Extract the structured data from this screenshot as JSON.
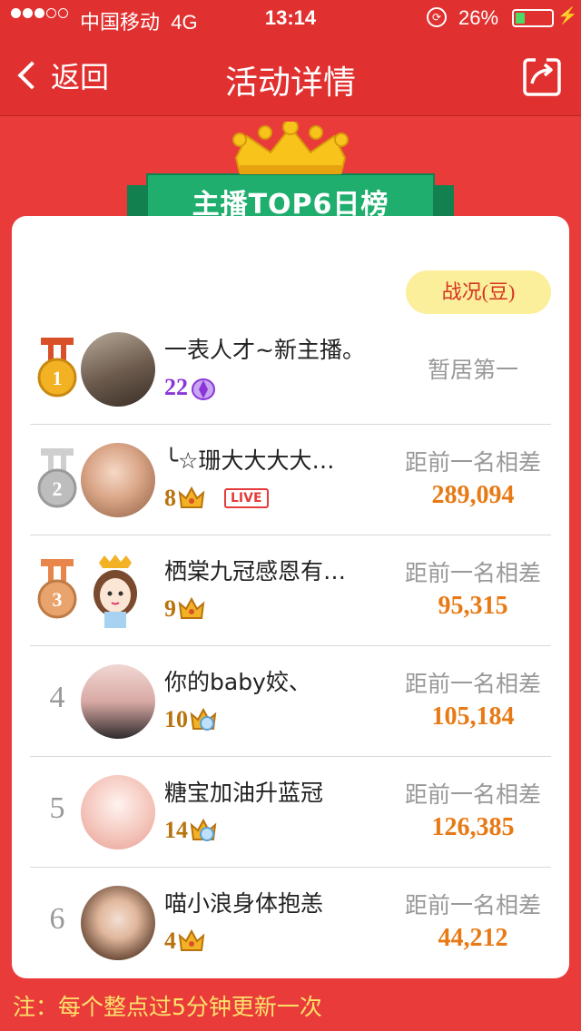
{
  "status_bar": {
    "carrier": "中国移动",
    "network": "4G",
    "time": "13:14",
    "battery": "26%",
    "battery_level": 0.26
  },
  "nav": {
    "back_label": "返回",
    "title": "活动详情"
  },
  "banner": {
    "title": "主播TOP6日榜"
  },
  "status_button": "战况(豆)",
  "rankings": [
    {
      "rank": "1",
      "name": "一表人才~新主播。",
      "level": "22",
      "level_icon": "diamond-crown-icon",
      "status": "暂居第一"
    },
    {
      "rank": "2",
      "name": "╰☆珊大大大大…",
      "level": "8",
      "level_icon": "crown-icon",
      "live": "LIVE",
      "gap_label": "距前一名相差",
      "gap": "289,094"
    },
    {
      "rank": "3",
      "name": "栖棠九冠感恩有…",
      "level": "9",
      "level_icon": "crown-icon",
      "gap_label": "距前一名相差",
      "gap": "95,315"
    },
    {
      "rank": "4",
      "name": "你的baby姣、",
      "level": "10",
      "level_icon": "jewel-crown-icon",
      "gap_label": "距前一名相差",
      "gap": "105,184"
    },
    {
      "rank": "5",
      "name": "糖宝加油升蓝冠",
      "level": "14",
      "level_icon": "jewel-crown-icon",
      "gap_label": "距前一名相差",
      "gap": "126,385"
    },
    {
      "rank": "6",
      "name": "喵小浪身体抱恙",
      "level": "4",
      "level_icon": "crown-icon",
      "gap_label": "距前一名相差",
      "gap": "44,212"
    }
  ],
  "footer_note": "注：每个整点过5分钟更新一次",
  "colors": {
    "background": "#ea3b3b",
    "nav": "#e0302f",
    "gap_value": "#e87914",
    "banner_green": "#1fae6e",
    "pill": "#fcef9c",
    "footer_text": "#fbe26a"
  }
}
